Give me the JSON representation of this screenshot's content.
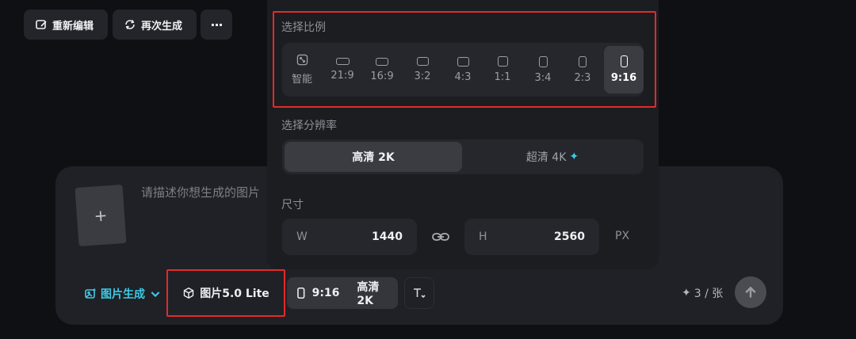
{
  "toolbar": {
    "reedit_label": "重新编辑",
    "regenerate_label": "再次生成",
    "more_label": "···"
  },
  "popup": {
    "ratio_title": "选择比例",
    "ratios": [
      {
        "label": "智能",
        "icon": "auto-ratio-icon"
      },
      {
        "label": "21:9",
        "icon": "ratio-21-9-icon"
      },
      {
        "label": "16:9",
        "icon": "ratio-16-9-icon"
      },
      {
        "label": "3:2",
        "icon": "ratio-3-2-icon"
      },
      {
        "label": "4:3",
        "icon": "ratio-4-3-icon"
      },
      {
        "label": "1:1",
        "icon": "ratio-1-1-icon"
      },
      {
        "label": "3:4",
        "icon": "ratio-3-4-icon"
      },
      {
        "label": "2:3",
        "icon": "ratio-2-3-icon"
      },
      {
        "label": "9:16",
        "icon": "ratio-9-16-icon"
      }
    ],
    "selected_ratio": "9:16",
    "resolution_title": "选择分辨率",
    "resolution_options": [
      "高清 2K",
      "超清 4K"
    ],
    "selected_resolution": "高清 2K",
    "size_title": "尺寸",
    "width_label": "W",
    "width_value": "1440",
    "height_label": "H",
    "height_value": "2560",
    "unit": "PX"
  },
  "composer": {
    "prompt_placeholder": "请描述你想生成的图片",
    "mode_label": "图片生成",
    "model_label": "图片5.0 Lite",
    "ratio_chip": "9:16",
    "resolution_chip": "高清 2K",
    "credits": "3 / 张"
  },
  "colors": {
    "accent": "#3fc9e6",
    "highlight_box": "#e32b2b",
    "background": "#0f1013"
  }
}
